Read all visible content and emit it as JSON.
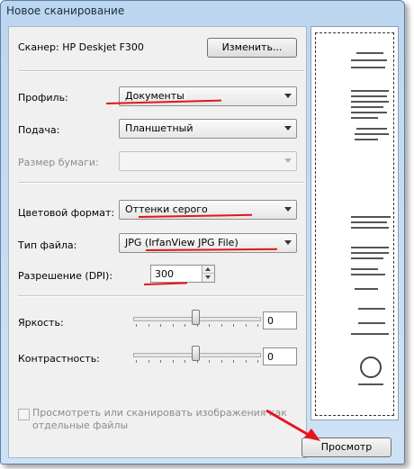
{
  "window": {
    "title": "Новое сканирование"
  },
  "scanner": {
    "label": "Сканер: HP Deskjet F300",
    "change_button": "Изменить..."
  },
  "profile": {
    "label": "Профиль:",
    "value": "Документы"
  },
  "source": {
    "label": "Подача:",
    "value": "Планшетный"
  },
  "paper_size": {
    "label": "Размер бумаги:",
    "value": ""
  },
  "color_format": {
    "label": "Цветовой формат:",
    "value": "Оттенки серого"
  },
  "file_type": {
    "label": "Тип файла:",
    "value": "JPG (IrfanView JPG File)"
  },
  "resolution": {
    "label": "Разрешение (DPI):",
    "value": "300"
  },
  "brightness": {
    "label": "Яркость:",
    "value": "0",
    "slider_fraction": 0.5
  },
  "contrast": {
    "label": "Контрастность:",
    "value": "0",
    "slider_fraction": 0.5
  },
  "separate_files": {
    "label": "Просмотреть или сканировать изображения как отдельные файлы",
    "checked": false
  },
  "preview_button": {
    "label": "Просмотр"
  },
  "colors": {
    "annotation": "#e5141e",
    "window_frame": "#bcd6ef",
    "panel": "#f0f0f0"
  }
}
